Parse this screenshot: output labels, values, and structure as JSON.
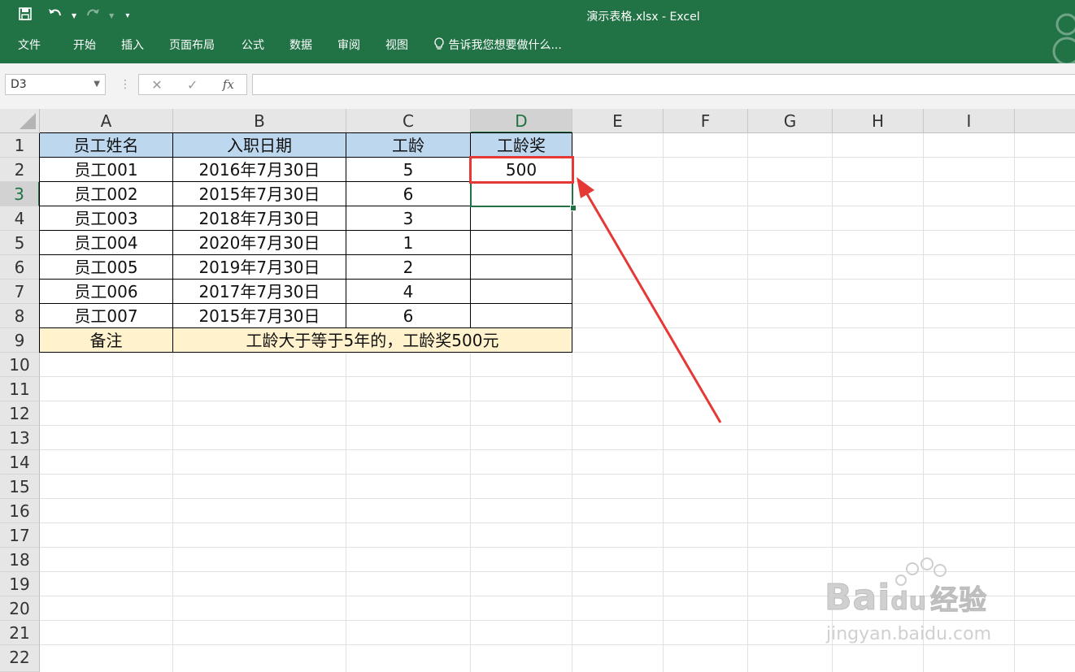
{
  "window": {
    "title": "演示表格.xlsx - Excel"
  },
  "qat": {
    "save_icon": "save-icon",
    "undo_icon": "undo-icon",
    "redo_icon": "redo-icon",
    "customize_icon": "customize-qat-icon"
  },
  "menu": [
    {
      "label": "文件"
    },
    {
      "label": "开始"
    },
    {
      "label": "插入"
    },
    {
      "label": "页面布局"
    },
    {
      "label": "公式"
    },
    {
      "label": "数据"
    },
    {
      "label": "审阅"
    },
    {
      "label": "视图"
    }
  ],
  "tellme": {
    "icon": "lightbulb-icon",
    "label": "告诉我您想要做什么..."
  },
  "formula_bar": {
    "name_box": "D3",
    "formula": "",
    "cancel": "✕",
    "enter": "✓",
    "fx": "fx"
  },
  "columns": [
    "A",
    "B",
    "C",
    "D",
    "E",
    "F",
    "G",
    "H",
    "I"
  ],
  "rows": [
    "1",
    "2",
    "3",
    "4",
    "5",
    "6",
    "7",
    "8",
    "9",
    "10",
    "11",
    "12",
    "13",
    "14",
    "15",
    "16",
    "17",
    "18",
    "19",
    "20",
    "21",
    "22"
  ],
  "selected": {
    "column": "D",
    "row": "3"
  },
  "table": {
    "headers": [
      "员工姓名",
      "入职日期",
      "工龄",
      "工龄奖"
    ],
    "rows": [
      [
        "员工001",
        "2016年7月30日",
        "5",
        "500"
      ],
      [
        "员工002",
        "2015年7月30日",
        "6",
        ""
      ],
      [
        "员工003",
        "2018年7月30日",
        "3",
        ""
      ],
      [
        "员工004",
        "2020年7月30日",
        "1",
        ""
      ],
      [
        "员工005",
        "2019年7月30日",
        "2",
        ""
      ],
      [
        "员工006",
        "2017年7月30日",
        "4",
        ""
      ],
      [
        "员工007",
        "2015年7月30日",
        "6",
        ""
      ]
    ],
    "note_label": "备注",
    "note_text": "工龄大于等于5年的，工龄奖500元"
  },
  "colors": {
    "excel_green": "#217346",
    "header_fill": "#bdd7ee",
    "note_fill": "#fff2cc",
    "annotation_red": "#e53935"
  },
  "watermark": {
    "brand": "Bai",
    "brand2": "du",
    "cn": "经验",
    "url": "jingyan.baidu.com"
  }
}
